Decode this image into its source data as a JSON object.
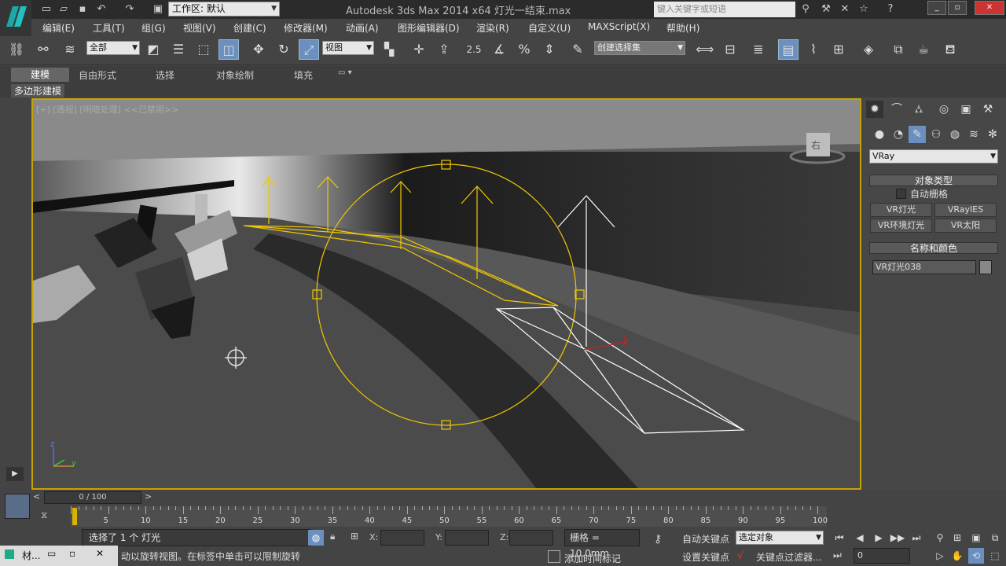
{
  "titlebar": {
    "workspace_label": "工作区: 默认",
    "app_title": "Autodesk 3ds Max  2014 x64     灯光一结束.max",
    "search_placeholder": "键入关键字或短语"
  },
  "menu": [
    "编辑(E)",
    "工具(T)",
    "组(G)",
    "视图(V)",
    "创建(C)",
    "修改器(M)",
    "动画(A)",
    "图形编辑器(D)",
    "渲染(R)",
    "自定义(U)",
    "MAXScript(X)",
    "帮助(H)"
  ],
  "toolbar": {
    "selection_filter": "全部",
    "reference_coord": "视图",
    "snap_label": "2.5",
    "named_selection_set": "创建选择集"
  },
  "ribbon": {
    "tabs": [
      "建模",
      "自由形式",
      "选择",
      "对象绘制",
      "填充"
    ],
    "sub_label": "多边形建模"
  },
  "viewport": {
    "label": "[+] [透视] [明暗处理]  <<已禁用>>",
    "viewcube_face": "右",
    "axis_x": "x",
    "axis_y": "y",
    "axis_z": "z"
  },
  "command_panel": {
    "category": "VRay",
    "object_type_header": "对象类型",
    "auto_grid": "自动栅格",
    "buttons": [
      "VR灯光",
      "VRayIES",
      "VR环境灯光",
      "VR太阳"
    ],
    "name_color_header": "名称和颜色",
    "object_name": "VR灯光038",
    "object_color": "#888888"
  },
  "timeline": {
    "slider_label": "0 / 100",
    "ticks": [
      5,
      10,
      15,
      20,
      25,
      30,
      35,
      40,
      45,
      50,
      55,
      60,
      65,
      70,
      75,
      80,
      85,
      90,
      95,
      100
    ]
  },
  "status": {
    "selection": "选择了 1 个 灯光",
    "prompt": "动以旋转视图。在标签中单击可以限制旋转",
    "x_label": "X:",
    "y_label": "Y:",
    "z_label": "Z:",
    "grid": "栅格 = 10.0mm",
    "add_time_tag": "添加时间标记",
    "auto_key": "自动关键点",
    "set_key": "设置关键点",
    "key_mode": "选定对象",
    "key_filters": "关键点过滤器...",
    "frame": "0"
  },
  "taskbar": {
    "item": "材..."
  }
}
